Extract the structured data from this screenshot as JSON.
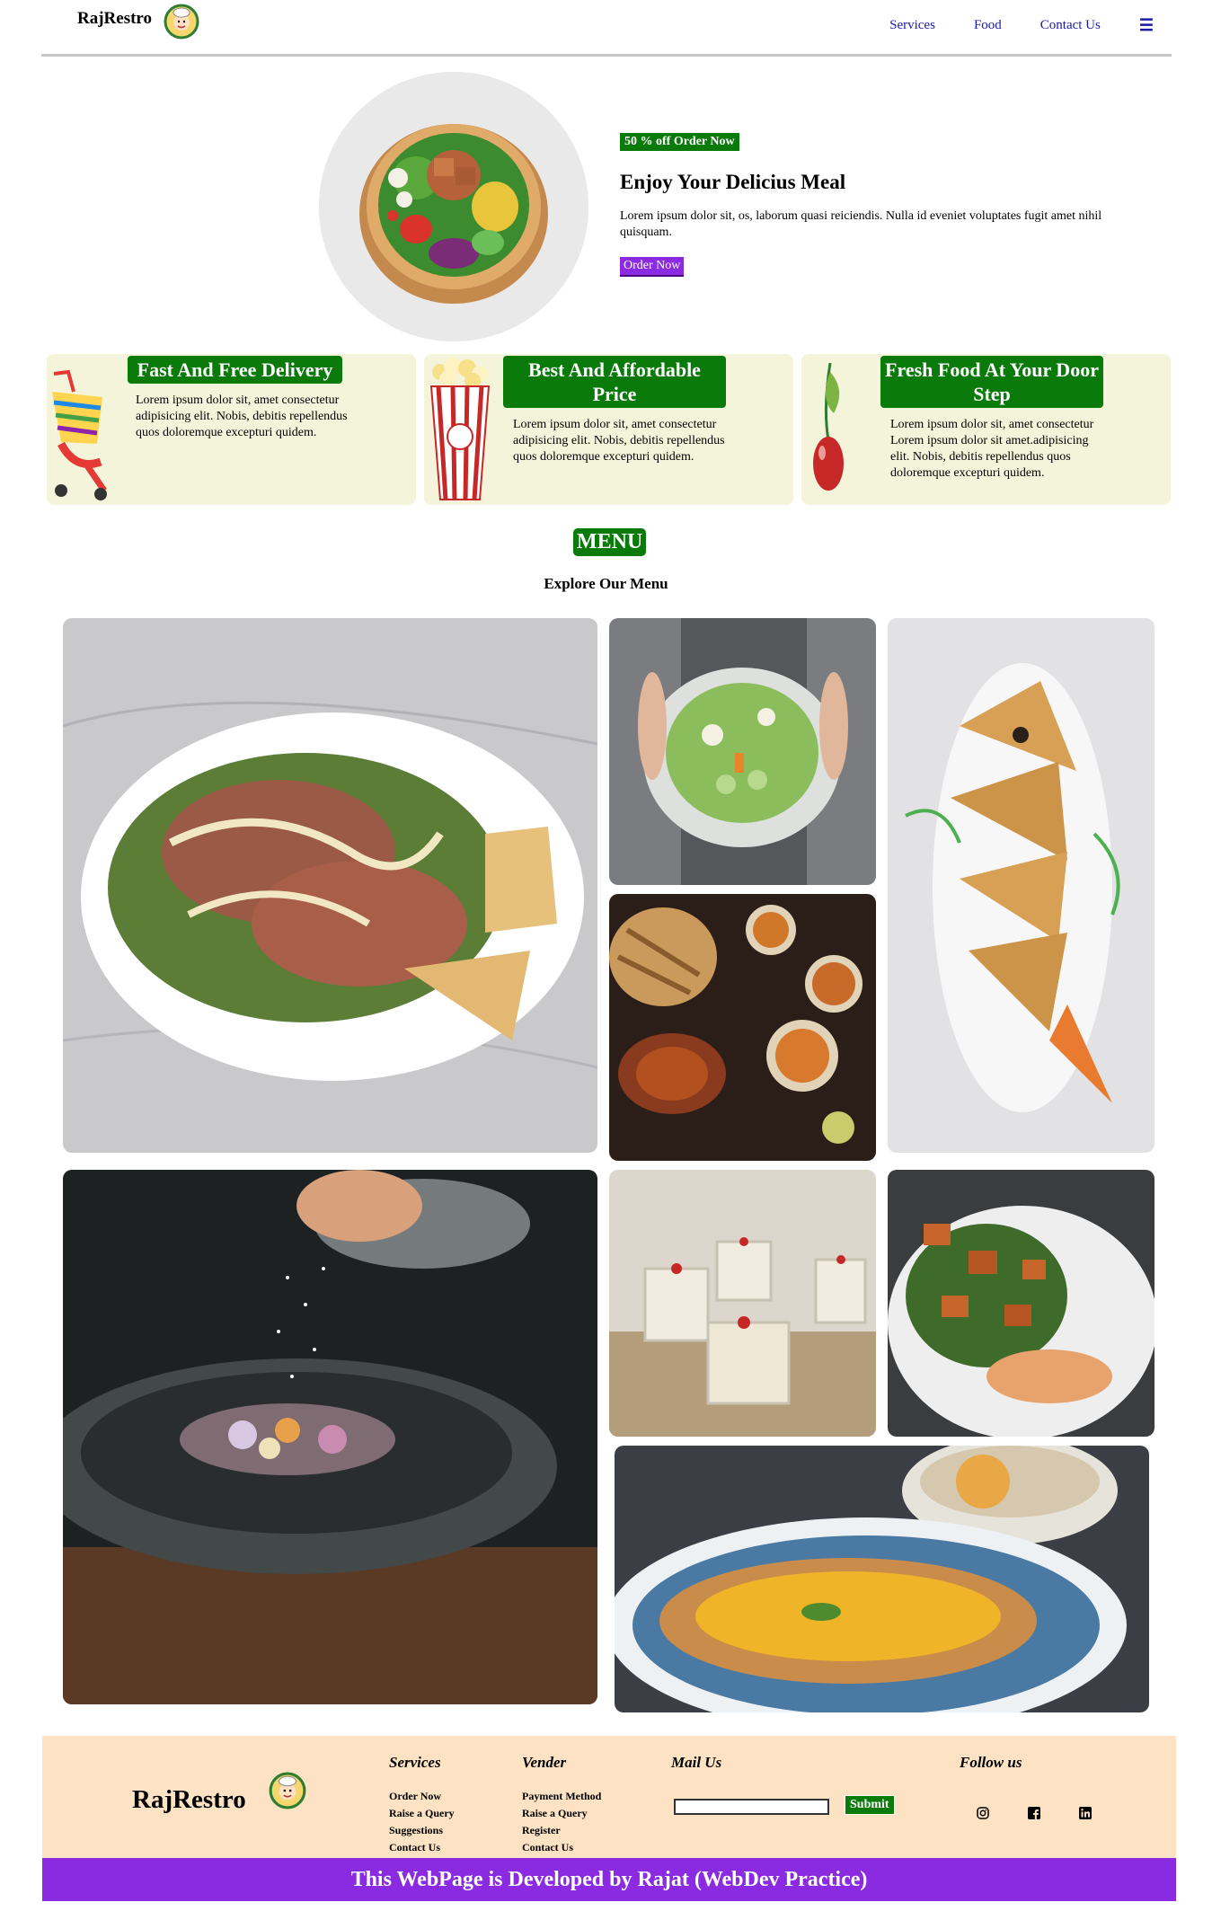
{
  "nav": {
    "brand": "RajRestro",
    "links": [
      "Services",
      "Food",
      "Contact Us"
    ],
    "menu_icon": "☰"
  },
  "hero": {
    "badge": "50 % off Order Now",
    "title": "Enjoy Your Delicius Meal",
    "description": "Lorem ipsum dolor sit, os, laborum quasi reiciendis. Nulla id eveniet voluptates fugit amet nihil quisquam.",
    "button": "Order Now"
  },
  "features": [
    {
      "title": "Fast And Free Delivery",
      "description": "Lorem ipsum dolor sit, amet consectetur adipisicing elit. Nobis, debitis repellendus quos doloremque excepturi quidem.",
      "icon": "cart-icon"
    },
    {
      "title": "Best And Affordable Price",
      "description": "Lorem ipsum dolor sit, amet consectetur adipisicing elit. Nobis, debitis repellendus quos doloremque excepturi quidem.",
      "icon": "popcorn-icon"
    },
    {
      "title": "Fresh Food At Your Door Step",
      "description": "Lorem ipsum dolor sit, amet consectetur Lorem ipsum dolor sit amet.adipisicing elit. Nobis, debitis repellendus quos doloremque excepturi quidem.",
      "icon": "cherry-icon"
    }
  ],
  "menu": {
    "title": "MENU",
    "subtitle": "Explore Our Menu"
  },
  "footer": {
    "brand": "RajRestro",
    "services": {
      "heading": "Services",
      "items": [
        "Order Now",
        "Raise a Query",
        "Suggestions",
        "Contact Us"
      ]
    },
    "vender": {
      "heading": "Vender",
      "items": [
        "Payment Method",
        "Raise a Query",
        "Register",
        "Contact Us"
      ]
    },
    "mail": {
      "heading": "Mail Us",
      "button": "Submit"
    },
    "follow": {
      "heading": "Follow us",
      "icons": [
        "instagram-icon",
        "facebook-icon",
        "linkedin-icon"
      ]
    },
    "copyright": "This WebPage is Developed by Rajat (WebDev Practice)"
  },
  "colors": {
    "accent_green": "#0a7a0a",
    "accent_purple": "#8a2be2",
    "footer_bg": "#fde3c4",
    "card_bg": "#f4f4da",
    "nav_link": "#1a1aa8"
  }
}
